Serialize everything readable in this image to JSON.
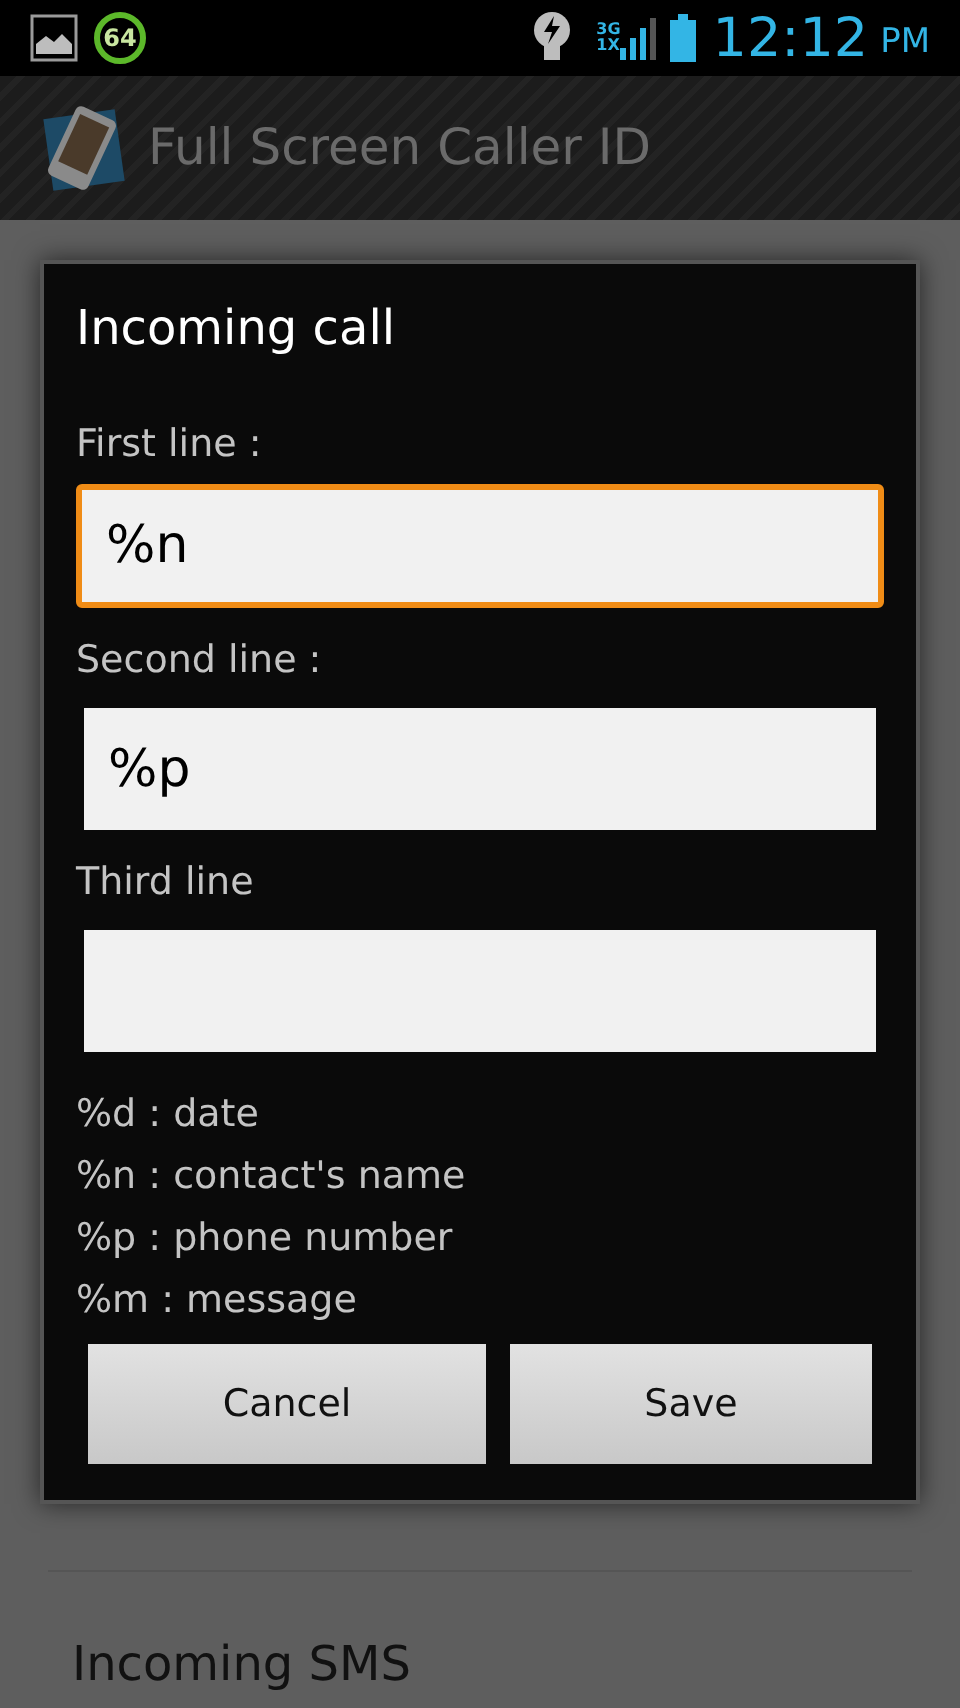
{
  "status_bar": {
    "badge": "64",
    "network_top": "3G",
    "network_bottom": "1X",
    "time": "12:12",
    "ampm": "PM"
  },
  "action_bar": {
    "title": "Full Screen Caller ID"
  },
  "settings_list": [
    {
      "label": "Incoming SMS"
    }
  ],
  "dialog": {
    "title": "Incoming call",
    "fields": [
      {
        "label": "First line :",
        "value": "%n",
        "focused": true
      },
      {
        "label": "Second line :",
        "value": "%p",
        "focused": false
      },
      {
        "label": "Third line",
        "focused": false
      }
    ],
    "hints": [
      "%d : date",
      "%n : contact's name",
      "%p : phone number",
      "%m : message"
    ],
    "buttons": [
      "Cancel",
      "Save"
    ]
  }
}
